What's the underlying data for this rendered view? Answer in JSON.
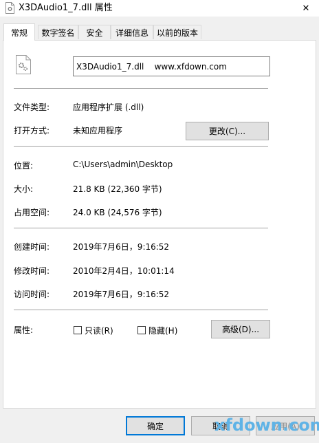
{
  "window": {
    "title": "X3DAudio1_7.dll 属性",
    "close_glyph": "✕"
  },
  "tabs": [
    {
      "label": "常规",
      "active": true
    },
    {
      "label": "数字签名",
      "active": false
    },
    {
      "label": "安全",
      "active": false
    },
    {
      "label": "详细信息",
      "active": false
    },
    {
      "label": "以前的版本",
      "active": false
    }
  ],
  "general": {
    "filename": "X3DAudio1_7.dll    www.xfdown.com",
    "file_type_label": "文件类型:",
    "file_type_value": "应用程序扩展 (.dll)",
    "opens_with_label": "打开方式:",
    "opens_with_value": "未知应用程序",
    "change_button": "更改(C)...",
    "location_label": "位置:",
    "location_value": "C:\\Users\\admin\\Desktop",
    "size_label": "大小:",
    "size_value": "21.8 KB (22,360 字节)",
    "size_on_disk_label": "占用空间:",
    "size_on_disk_value": "24.0 KB (24,576 字节)",
    "created_label": "创建时间:",
    "created_value": "2019年7月6日，9:16:52",
    "modified_label": "修改时间:",
    "modified_value": "2010年2月4日，10:01:14",
    "accessed_label": "访问时间:",
    "accessed_value": "2019年7月6日，9:16:52",
    "attributes_label": "属性:",
    "readonly_label": "只读(R)",
    "hidden_label": "隐藏(H)",
    "advanced_button": "高级(D)..."
  },
  "footer": {
    "ok_button": "确定",
    "cancel_button": "取消",
    "apply_button": "应用(A)"
  },
  "watermark": "xfdown.com",
  "colors": {
    "accent": "#0078d7",
    "panel": "#ffffff",
    "background": "#f0f0f0"
  }
}
